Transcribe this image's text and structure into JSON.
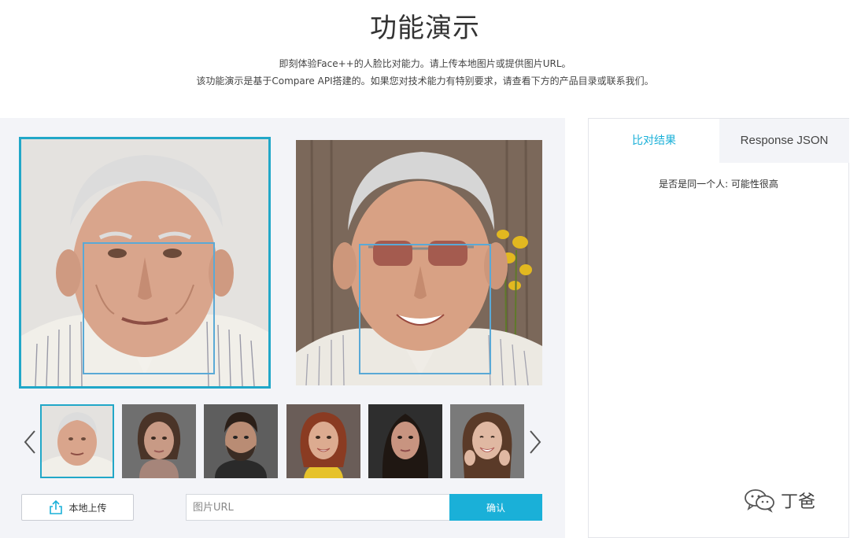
{
  "header": {
    "title": "功能演示",
    "intro_line1": "即刻体验Face++的人脸比对能力。请上传本地图片或提供图片URL。",
    "intro_line2": "该功能演示是基于Compare API搭建的。如果您对技术能力有特别要求，请查看下方的产品目录或联系我们。"
  },
  "controls": {
    "upload_label": "本地上传",
    "url_placeholder": "图片URL",
    "confirm_label": "确认"
  },
  "result_panel": {
    "tabs": [
      {
        "label": "比对结果",
        "active": true
      },
      {
        "label": "Response JSON",
        "active": false
      }
    ],
    "result_text": "是否是同一个人: 可能性很高"
  },
  "thumbnails": [
    {
      "name": "elderly-man",
      "selected": true
    },
    {
      "name": "woman-1",
      "selected": false
    },
    {
      "name": "man-beard",
      "selected": false
    },
    {
      "name": "woman-2",
      "selected": false
    },
    {
      "name": "woman-3",
      "selected": false
    },
    {
      "name": "woman-4",
      "selected": false
    }
  ],
  "watermark": {
    "text": "丁爸"
  },
  "colors": {
    "accent": "#1ab0d8",
    "selected_border": "#21a7c8",
    "face_box": "#5aa9d6",
    "panel_bg": "#f3f4f8"
  },
  "icons": {
    "upload": "upload-icon",
    "prev": "chevron-left-icon",
    "next": "chevron-right-icon",
    "watermark": "wechat-icon"
  }
}
